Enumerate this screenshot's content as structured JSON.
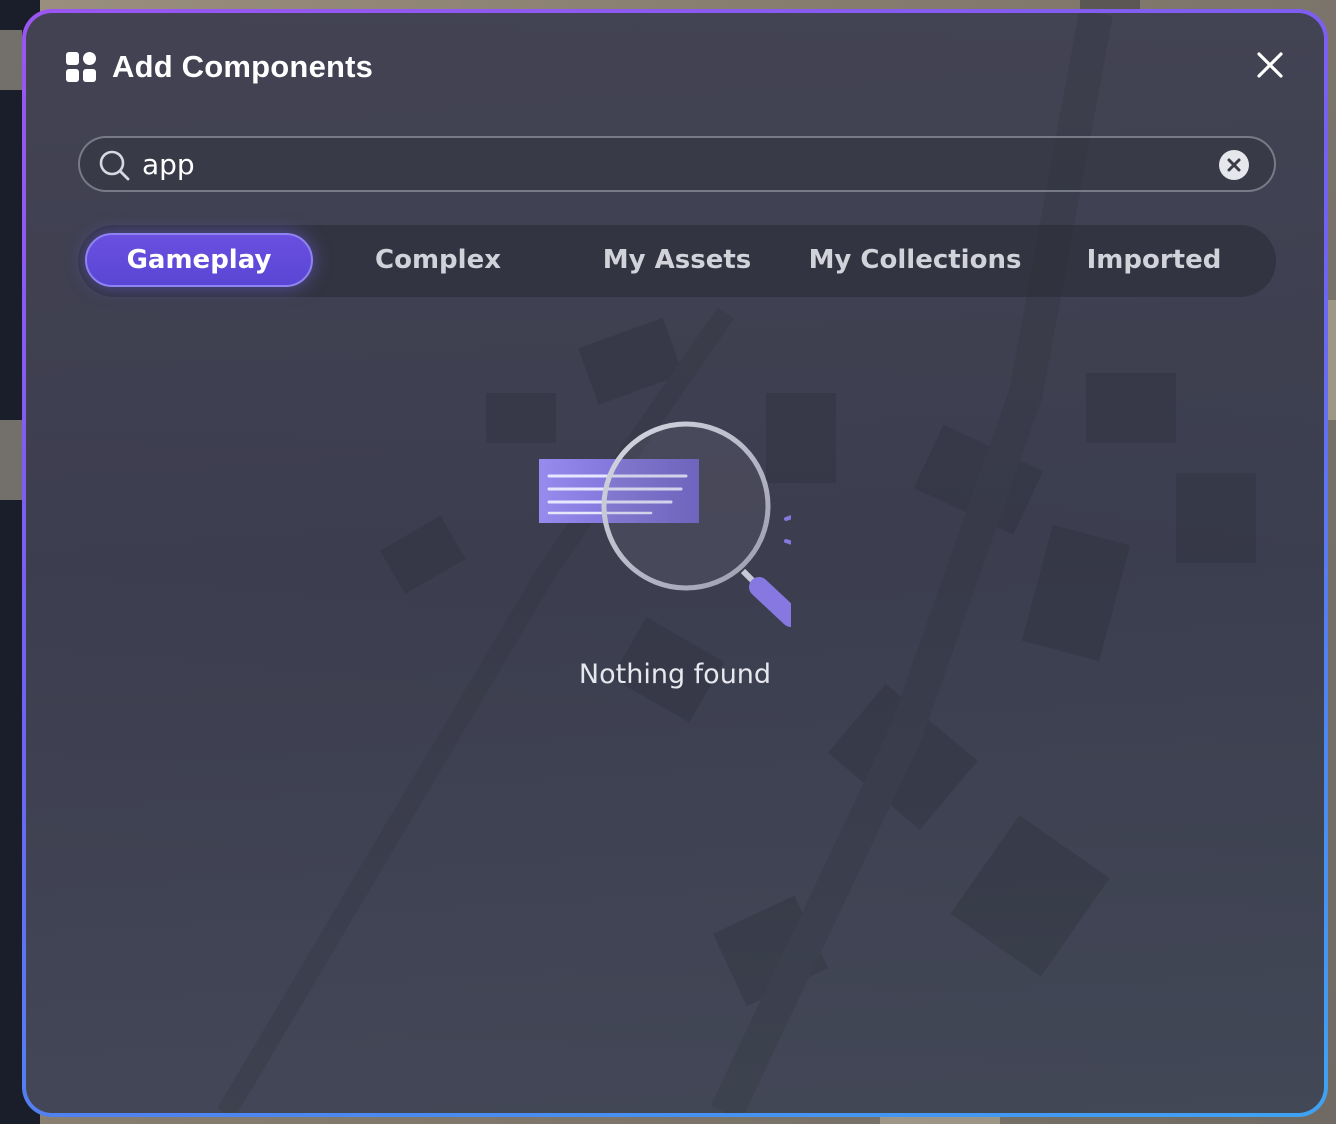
{
  "dialog": {
    "title": "Add Components",
    "title_icon": "grid-icon",
    "close_icon": "close-icon"
  },
  "search": {
    "value": "app",
    "placeholder": "",
    "search_icon": "search-icon",
    "clear_icon": "clear-icon"
  },
  "tabs": [
    {
      "label": "Gameplay",
      "active": true
    },
    {
      "label": "Complex",
      "active": false
    },
    {
      "label": "My Assets",
      "active": false
    },
    {
      "label": "My Collections",
      "active": false
    },
    {
      "label": "Imported",
      "active": false
    }
  ],
  "empty_state": {
    "icon": "magnifier-document-icon",
    "message": "Nothing found"
  },
  "colors": {
    "accent": "#5b48d6",
    "border_gradient": [
      "#9a56f0",
      "#3fa2f2"
    ],
    "panel": "#41434f",
    "text": "#ffffff"
  }
}
